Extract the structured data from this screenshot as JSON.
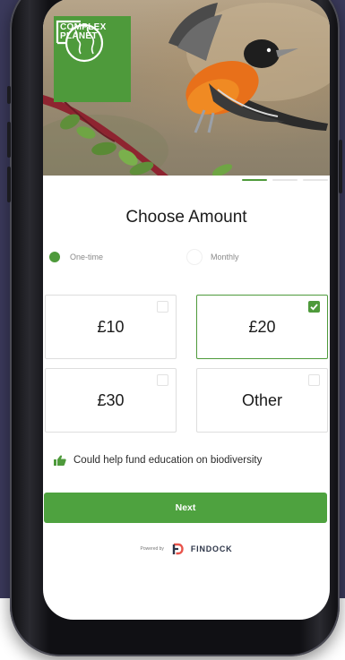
{
  "brand": {
    "logo_line1": "COMPLEX",
    "logo_line2": "PLANET"
  },
  "carousel": {
    "active_index": 0,
    "count": 3
  },
  "form": {
    "title": "Choose Amount",
    "frequency": {
      "options": [
        "One-time",
        "Monthly"
      ],
      "selected": "One-time"
    },
    "amounts": [
      {
        "label": "£10",
        "selected": false
      },
      {
        "label": "£20",
        "selected": true
      },
      {
        "label": "£30",
        "selected": false
      },
      {
        "label": "Other",
        "selected": false
      }
    ],
    "impact_message": "Could help fund education on biodiversity",
    "next_label": "Next"
  },
  "footer": {
    "powered_by": "Powered by",
    "brand_name": "FINDOCK"
  },
  "colors": {
    "accent": "#4e9a3b",
    "background": "#3b3a5c"
  }
}
